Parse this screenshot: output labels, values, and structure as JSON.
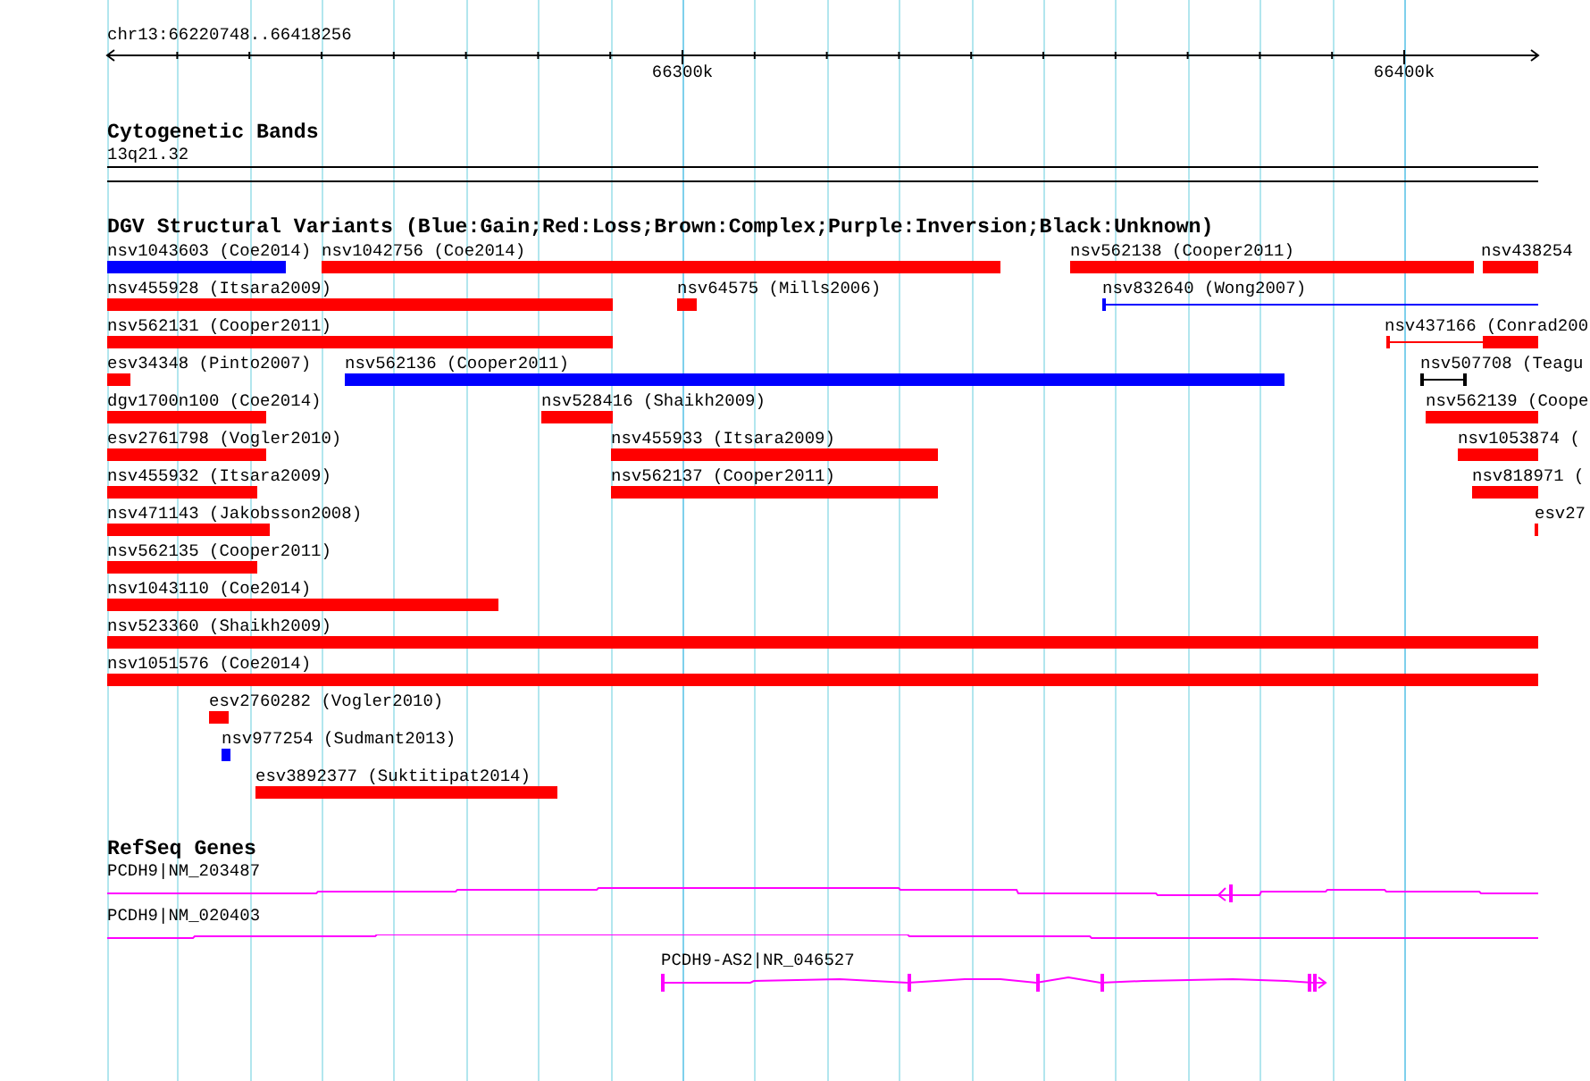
{
  "ruler": {
    "region": "chr13:66220748..66418256",
    "ticks": [
      {
        "label": "66300k"
      },
      {
        "label": "66400k"
      }
    ]
  },
  "tracks": [
    {
      "kind": "cytoband",
      "title": "Cytogenetic Bands",
      "band": "13q21.32"
    },
    {
      "kind": "variants",
      "title": "DGV Structural Variants (Blue:Gain;Red:Loss;Brown:Complex;Purple:Inversion;Black:Unknown)",
      "rows": [
        {
          "features": [
            {
              "label": "nsv1043603 (Coe2014)",
              "kind": "bar",
              "color": "#0000ff"
            },
            {
              "label": "nsv1042756 (Coe2014)",
              "kind": "bar",
              "color": "#ff0000"
            },
            {
              "label": "nsv562138 (Cooper2011)",
              "kind": "bar",
              "color": "#ff0000"
            },
            {
              "label": "nsv438254",
              "kind": "bar",
              "color": "#ff0000"
            }
          ]
        },
        {
          "features": [
            {
              "label": "nsv455928 (Itsara2009)",
              "kind": "bar",
              "color": "#ff0000"
            },
            {
              "label": "nsv64575 (Mills2006)",
              "kind": "bar",
              "color": "#ff0000"
            },
            {
              "label": "nsv832640 (Wong2007)",
              "kind": "line",
              "color": "#0000ff"
            }
          ]
        },
        {
          "features": [
            {
              "label": "nsv562131 (Cooper2011)",
              "kind": "bar",
              "color": "#ff0000"
            },
            {
              "label": "nsv437166 (Conrad200",
              "kind": "line-bar",
              "color": "#ff0000"
            }
          ]
        },
        {
          "features": [
            {
              "label": "esv34348 (Pinto2007)",
              "kind": "bar",
              "color": "#ff0000"
            },
            {
              "label": "nsv562136 (Cooper2011)",
              "kind": "bar",
              "color": "#0000ff"
            },
            {
              "label": "nsv507708 (Teagu",
              "kind": "whisker",
              "color": "#000000"
            }
          ]
        },
        {
          "features": [
            {
              "label": "dgv1700n100 (Coe2014)",
              "kind": "bar",
              "color": "#ff0000"
            },
            {
              "label": "nsv528416 (Shaikh2009)",
              "kind": "bar",
              "color": "#ff0000"
            },
            {
              "label": "nsv562139 (Coope",
              "kind": "bar",
              "color": "#ff0000"
            }
          ]
        },
        {
          "features": [
            {
              "label": "esv2761798 (Vogler2010)",
              "kind": "bar",
              "color": "#ff0000"
            },
            {
              "label": "nsv455933 (Itsara2009)",
              "kind": "bar",
              "color": "#ff0000"
            },
            {
              "label": "nsv1053874 (",
              "kind": "bar",
              "color": "#ff0000"
            }
          ]
        },
        {
          "features": [
            {
              "label": "nsv455932 (Itsara2009)",
              "kind": "bar",
              "color": "#ff0000"
            },
            {
              "label": "nsv562137 (Cooper2011)",
              "kind": "bar",
              "color": "#ff0000"
            },
            {
              "label": "nsv818971 (",
              "kind": "bar",
              "color": "#ff0000"
            }
          ]
        },
        {
          "features": [
            {
              "label": "nsv471143 (Jakobsson2008)",
              "kind": "bar",
              "color": "#ff0000"
            },
            {
              "label": "esv27",
              "kind": "bar",
              "color": "#ff0000"
            }
          ]
        },
        {
          "features": [
            {
              "label": "nsv562135 (Cooper2011)",
              "kind": "bar",
              "color": "#ff0000"
            }
          ]
        },
        {
          "features": [
            {
              "label": "nsv1043110 (Coe2014)",
              "kind": "bar",
              "color": "#ff0000"
            }
          ]
        },
        {
          "features": [
            {
              "label": "nsv523360 (Shaikh2009)",
              "kind": "bar",
              "color": "#ff0000"
            }
          ]
        },
        {
          "features": [
            {
              "label": "nsv1051576 (Coe2014)",
              "kind": "bar",
              "color": "#ff0000"
            }
          ]
        },
        {
          "features": [
            {
              "label": "esv2760282 (Vogler2010)",
              "kind": "bar",
              "color": "#ff0000"
            }
          ]
        },
        {
          "features": [
            {
              "label": "nsv977254 (Sudmant2013)",
              "kind": "bar",
              "color": "#0000ff"
            }
          ]
        },
        {
          "features": [
            {
              "label": "esv3892377 (Suktitipat2014)",
              "kind": "bar",
              "color": "#ff0000"
            }
          ]
        }
      ]
    },
    {
      "kind": "genes",
      "title": "RefSeq Genes",
      "genes": [
        {
          "label": "PCDH9|NM_203487"
        },
        {
          "label": "PCDH9|NM_020403"
        },
        {
          "label": "PCDH9-AS2|NR_046527"
        }
      ]
    }
  ]
}
